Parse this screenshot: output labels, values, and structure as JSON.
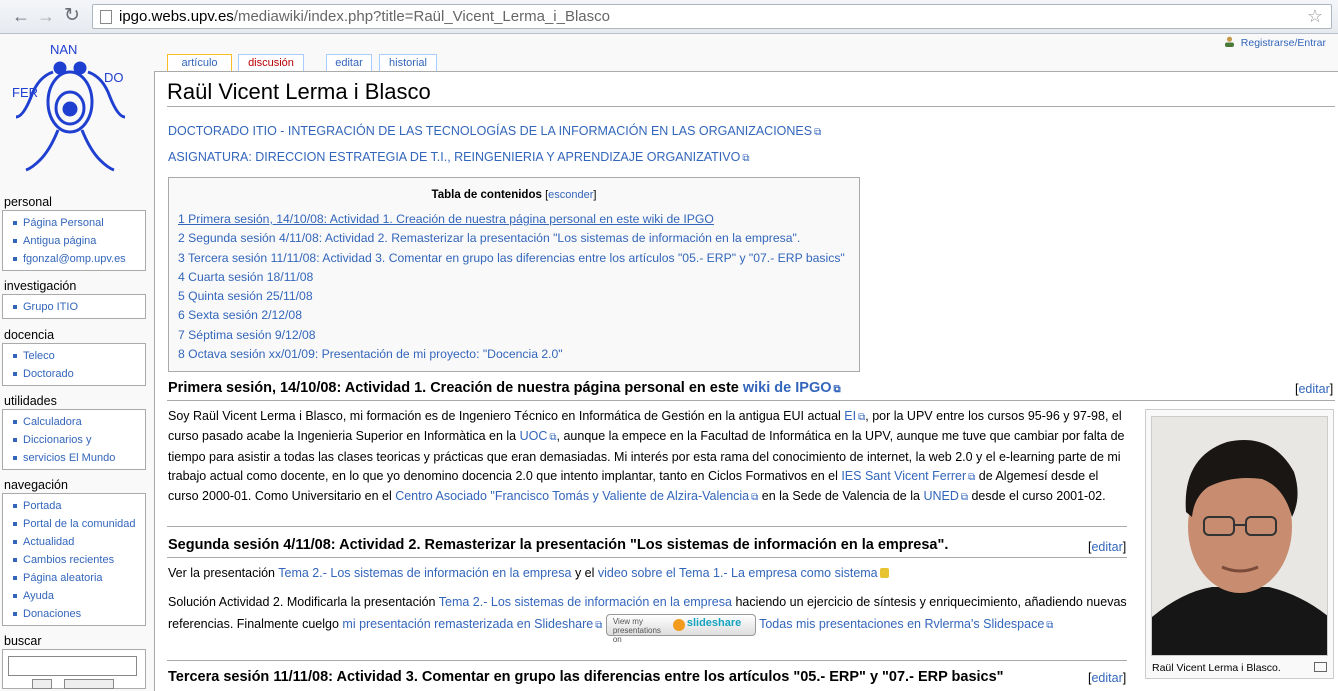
{
  "browser": {
    "url_domain": "ipgo.webs.upv.es",
    "url_rest": "/mediawiki/index.php?title=Raül_Vicent_Lerma_i_Blasco"
  },
  "personal_bar": {
    "login": "Registrarse/Entrar"
  },
  "tabs": {
    "article": "artículo",
    "discussion": "discusión",
    "edit": "editar",
    "history": "historial"
  },
  "sidebar": {
    "personal": {
      "title": "personal",
      "items": [
        "Página Personal",
        "Antigua página",
        "fgonzal@omp.upv.es"
      ]
    },
    "investigacion": {
      "title": "investigación",
      "items": [
        "Grupo ITIO"
      ]
    },
    "docencia": {
      "title": "docencia",
      "items": [
        "Teleco",
        "Doctorado"
      ]
    },
    "utilidades": {
      "title": "utilidades",
      "items": [
        "Calculadora",
        "Diccionarios y",
        "servicios El Mundo"
      ]
    },
    "navegacion": {
      "title": "navegación",
      "items": [
        "Portada",
        "Portal de la comunidad",
        "Actualidad",
        "Cambios recientes",
        "Página aleatoria",
        "Ayuda",
        "Donaciones"
      ]
    },
    "buscar": {
      "title": "buscar"
    }
  },
  "page": {
    "title": "Raül Vicent Lerma i Blasco",
    "link_doctorado": "DOCTORADO ITIO - INTEGRACIÓN DE LAS TECNOLOGÍAS DE LA INFORMACIÓN EN LAS ORGANIZACIONES",
    "link_asignatura": "ASIGNATURA: DIRECCION ESTRATEGIA DE T.I., REINGENIERIA Y APRENDIZAJE ORGANIZATIVO"
  },
  "toc": {
    "title": "Tabla de contenidos",
    "hide": "esconder",
    "items": [
      "1 Primera sesión, 14/10/08: Actividad 1. Creación de nuestra página personal en este wiki de IPGO",
      "2 Segunda sesión 4/11/08: Actividad 2. Remasterizar la presentación \"Los sistemas de información en la empresa\".",
      "3 Tercera sesión 11/11/08: Actividad 3. Comentar en grupo las diferencias entre los artículos \"05.- ERP\" y \"07.- ERP basics\"",
      "4 Cuarta sesión 18/11/08",
      "5 Quinta sesión 25/11/08",
      "6 Sexta sesión 2/12/08",
      "7 Séptima sesión 9/12/08",
      "8 Octava sesión xx/01/09: Presentación de mi proyecto: \"Docencia 2.0\""
    ]
  },
  "section1": {
    "heading": "Primera sesión, 14/10/08: Actividad 1. Creación de nuestra página personal en este ",
    "heading_link": "wiki de IPGO",
    "edit": "editar",
    "t1": "Soy Raül Vicent Lerma i Blasco, mi formación es de Ingeniero Técnico en Informática de Gestión en la antigua EUI actual ",
    "l1": "EI",
    "t2": ", por la UPV entre los cursos 95-96 y 97-98, el curso pasado acabe la Ingenieria Superior en Informàtica en la ",
    "l2": "UOC",
    "t3": ", aunque la empece en la Facultad de Informática en la UPV, aunque me tuve que cambiar por falta de tiempo para asistir a todas las clases teoricas y prácticas que eran demasiadas. Mi interés por esta rama del conocimiento de internet, la web 2.0 y el e-learning parte de mi trabajo actual como docente, en lo que yo denomino docencia 2.0 que intento implantar, tanto en Ciclos Formativos en el ",
    "l3": "IES Sant Vicent Ferrer",
    "t4": " de Algemesí desde el curso 2000-01. Como Universitario en el ",
    "l4": "Centro Asociado \"Francisco Tomás y Valiente de Alzira-Valencia",
    "t5": " en la Sede de Valencia de la ",
    "l5": "UNED",
    "t6": " desde el curso 2001-02."
  },
  "section2": {
    "heading": "Segunda sesión 4/11/08: Actividad 2. Remasterizar la presentación \"Los sistemas de información en la empresa\".",
    "edit": "editar",
    "p1_t1": "Ver la presentación ",
    "p1_l1": "Tema 2.- Los sistemas de información en la empresa",
    "p1_t2": " y el ",
    "p1_l2": "video sobre el Tema 1.- La empresa como sistema",
    "p2_t1": "Solución Actividad 2. Modificarla la presentación ",
    "p2_l1": "Tema 2.- Los sistemas de información en la empresa",
    "p2_t2": " haciendo un ejercicio de síntesis y enriquecimiento, añadiendo nuevas referencias. Finalmente cuelgo ",
    "p2_l2": "mi presentación remasterizada en Slideshare",
    "badge_text": "View my presentations on",
    "badge_brand": "slideshare",
    "p2_l3": "Todas mis presentaciones en Rvlerma's Slidespace"
  },
  "section3": {
    "heading": "Tercera sesión 11/11/08: Actividad 3. Comentar en grupo las diferencias entre los artículos \"05.- ERP\" y \"07.- ERP basics\"",
    "edit": "editar"
  },
  "thumb": {
    "caption": "Raül Vicent Lerma i Blasco."
  }
}
